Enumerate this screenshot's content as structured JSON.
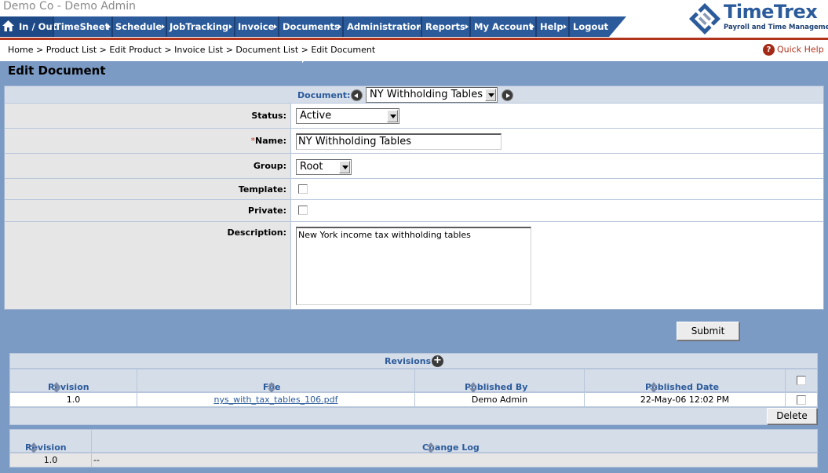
{
  "header": {
    "company": "Demo Co - Demo Admin",
    "logo": {
      "name": "TimeTrex",
      "tagline": "Payroll and Time Management"
    },
    "nav": [
      {
        "label": "In / Out"
      },
      {
        "label": "TimeSheet"
      },
      {
        "label": "Schedule"
      },
      {
        "label": "JobTracking"
      },
      {
        "label": "Invoice"
      },
      {
        "label": "Documents"
      },
      {
        "label": "Administration"
      },
      {
        "label": "Reports"
      },
      {
        "label": "My Account"
      },
      {
        "label": "Help"
      },
      {
        "label": "Logout"
      }
    ]
  },
  "breadcrumb": "Home > Product List > Edit Product > Invoice List > Document List > Edit Document",
  "quick_help": "Quick Help",
  "page_title": "Edit Document",
  "form": {
    "document_label": "Document:",
    "document_value": "NY Withholding Tables",
    "status_label": "Status:",
    "status_value": "Active",
    "name_required": "*",
    "name_label": "Name:",
    "name_value": "NY Withholding Tables",
    "group_label": "Group:",
    "group_value": "Root",
    "template_label": "Template:",
    "private_label": "Private:",
    "description_label": "Description:",
    "description_value": "New York income tax withholding tables",
    "submit_label": "Submit"
  },
  "revisions": {
    "title": "Revisions",
    "columns": [
      "Revision",
      "File",
      "Published By",
      "Published Date"
    ],
    "rows": [
      {
        "revision": "1.0",
        "file": "nys_with_tax_tables_106.pdf",
        "published_by": "Demo Admin",
        "published_date": "22-May-06 12:02 PM"
      }
    ],
    "delete_label": "Delete"
  },
  "change_log": {
    "columns": [
      "Revision",
      "Change Log"
    ],
    "rows": [
      {
        "revision": "1.0",
        "log": "--"
      }
    ]
  },
  "colors": {
    "nav": "#2b5b9b",
    "accent_red": "#b0331c",
    "page_bg": "#7b9bc5"
  }
}
